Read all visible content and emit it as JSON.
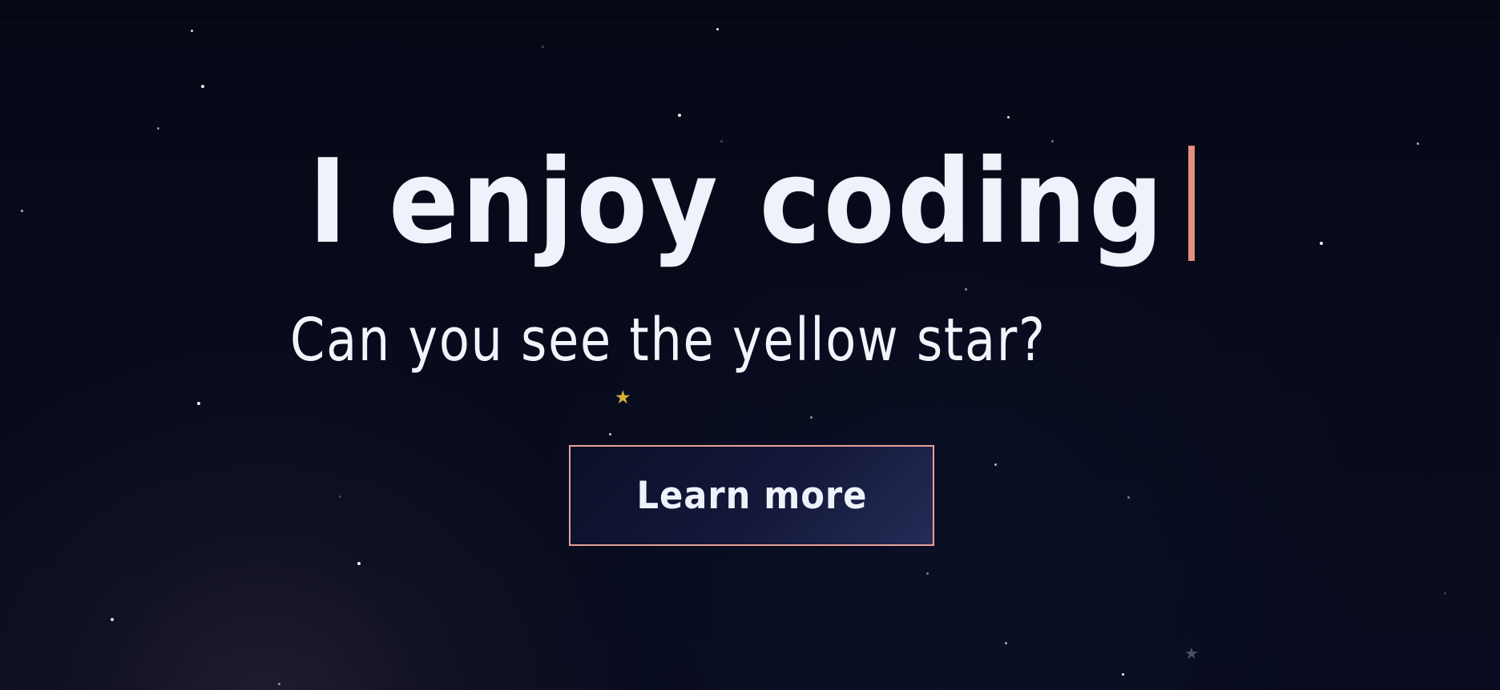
{
  "hero": {
    "headline": "I enjoy coding",
    "subtitle": "Can you see the yellow star?",
    "button_label": "Learn more"
  },
  "decorations": {
    "star_glyph": "★",
    "yellow_star_color": "#d6b13a",
    "faint_star_color": "#4d4f60",
    "caret_color": "#e39080",
    "button_border_color": "#e8a095"
  }
}
